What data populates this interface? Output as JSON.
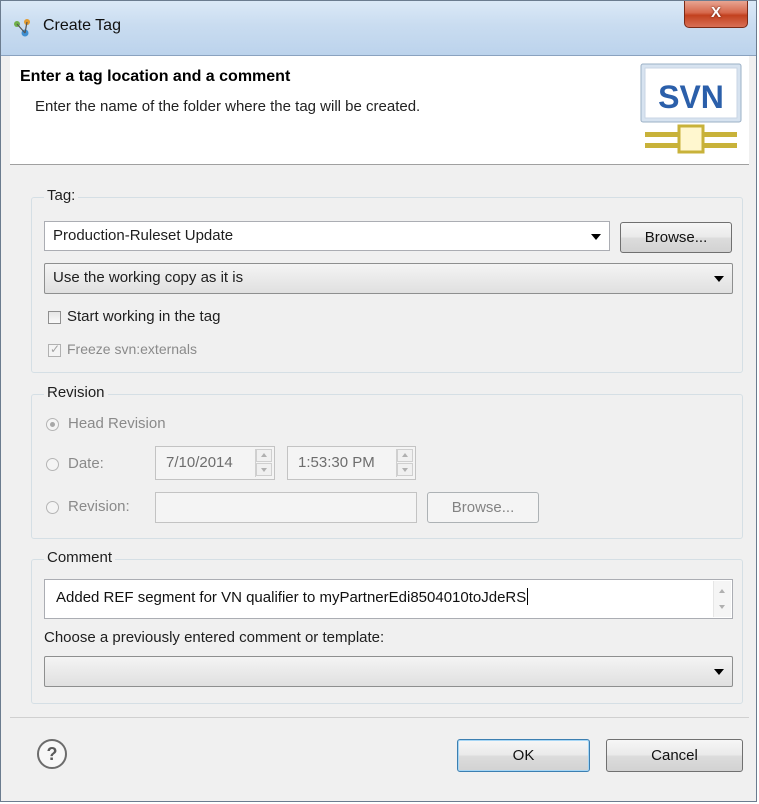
{
  "window": {
    "title": "Create Tag",
    "close_glyph": "X"
  },
  "banner": {
    "title": "Enter a tag location and a comment",
    "description": "Enter the name of the folder where the tag will be created.",
    "logo_text": "SVN"
  },
  "tag": {
    "group_label": "Tag:",
    "location_value": "Production-Ruleset Update",
    "browse_label": "Browse...",
    "source_option": "Use the working copy as it is",
    "start_working_label": "Start working in the tag",
    "start_working_checked": false,
    "freeze_externals_label": "Freeze svn:externals",
    "freeze_externals_checked": true
  },
  "revision": {
    "group_label": "Revision",
    "head_label": "Head Revision",
    "head_selected": true,
    "date_label": "Date:",
    "date_value": "7/10/2014",
    "time_value": "1:53:30 PM",
    "revision_label": "Revision:",
    "revision_value": "",
    "browse_label": "Browse..."
  },
  "comment": {
    "group_label": "Comment",
    "text": "Added REF segment for VN qualifier to myPartnerEdi8504010toJdeRS",
    "history_label": "Choose a previously entered comment or template:",
    "history_value": ""
  },
  "footer": {
    "help_glyph": "?",
    "ok_label": "OK",
    "cancel_label": "Cancel"
  },
  "colors": {
    "dialog_bg": "#f0f0f0",
    "svn_blue": "#2b5faa",
    "svn_gold": "#c8b23a"
  }
}
